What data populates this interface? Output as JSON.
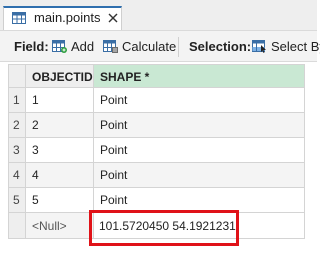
{
  "tab": {
    "title": "main.points",
    "icon": "table-icon",
    "close_icon": "close-icon"
  },
  "toolbar": {
    "field_label": "Field:",
    "add_label": "Add",
    "calculate_label": "Calculate",
    "selection_label": "Selection:",
    "select_by_label": "Select By"
  },
  "table": {
    "columns": [
      "OBJECTID *",
      "SHAPE *"
    ],
    "rows": [
      {
        "num": "1",
        "objectid": "1",
        "shape": "Point"
      },
      {
        "num": "2",
        "objectid": "2",
        "shape": "Point"
      },
      {
        "num": "3",
        "objectid": "3",
        "shape": "Point"
      },
      {
        "num": "4",
        "objectid": "4",
        "shape": "Point"
      },
      {
        "num": "5",
        "objectid": "5",
        "shape": "Point"
      }
    ],
    "new_row": {
      "objectid": "<Null>",
      "shape": "101.5720450 54.1921231"
    }
  },
  "colors": {
    "accent": "#2f6fae",
    "shape_header": "#c9e8d3",
    "highlight": "#e01218"
  }
}
